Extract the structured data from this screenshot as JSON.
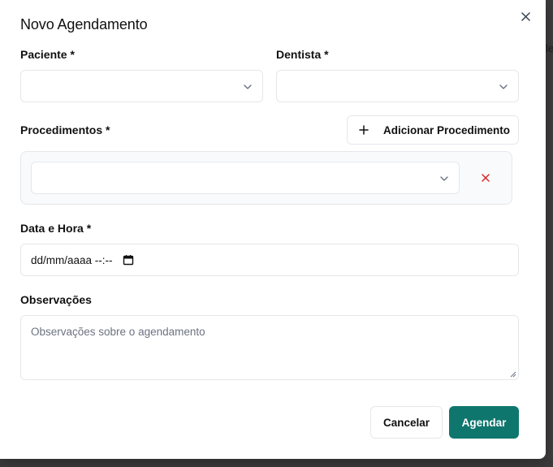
{
  "backdrop": {
    "peek_text": "le"
  },
  "dialog": {
    "title": "Novo Agendamento",
    "close_icon": "close-icon"
  },
  "form": {
    "patient": {
      "label": "Paciente *",
      "value": ""
    },
    "dentist": {
      "label": "Dentista *",
      "value": ""
    },
    "procedures": {
      "label": "Procedimentos *",
      "add_button_label": "Adicionar Procedimento",
      "items": [
        {
          "value": ""
        }
      ]
    },
    "datetime": {
      "label": "Data e Hora *",
      "display_value": "dd/mm/aaaa --:--"
    },
    "notes": {
      "label": "Observações",
      "placeholder": "Observações sobre o agendamento",
      "value": ""
    }
  },
  "footer": {
    "cancel_label": "Cancelar",
    "submit_label": "Agendar"
  },
  "colors": {
    "primary": "#0f766e",
    "danger": "#dc2626",
    "border": "#e5e7eb"
  }
}
